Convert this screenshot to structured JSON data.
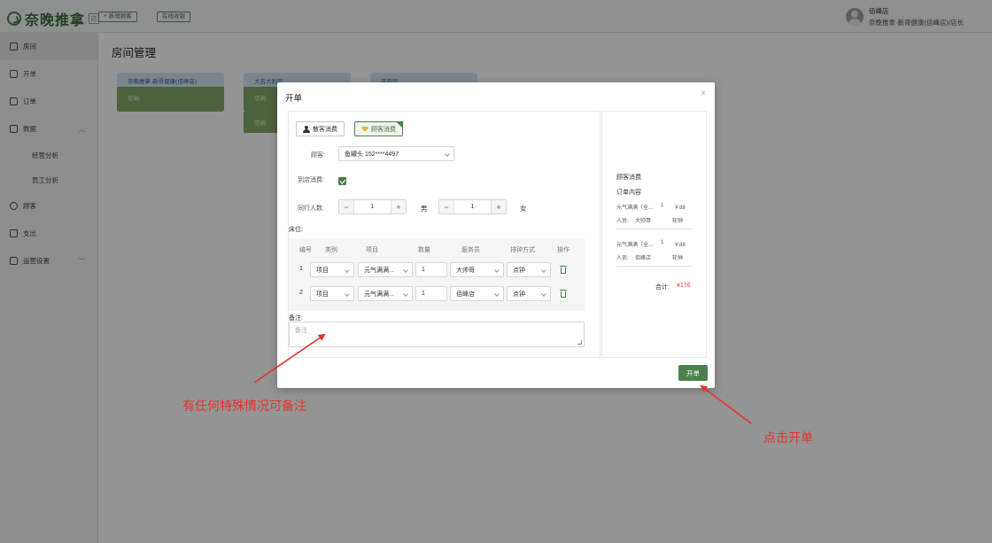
{
  "app": {
    "logo_text": "奈晚推拿",
    "logo_badge": "店",
    "new_guest_label": "+ 新增顾客",
    "online_order_label": "在线收银"
  },
  "user": {
    "name": "佰峰店",
    "store": "奈晚推拿·新哥健康(佰峰店)/店长"
  },
  "sidebar": {
    "items": [
      {
        "label": "房间"
      },
      {
        "label": "开单"
      },
      {
        "label": "订单"
      },
      {
        "label": "数据"
      },
      {
        "label": "顾客"
      },
      {
        "label": "支出"
      },
      {
        "label": "运营设置"
      }
    ],
    "sub_items": [
      {
        "label": "经营分析"
      },
      {
        "label": "员工分析"
      }
    ]
  },
  "main": {
    "title": "房间管理",
    "rooms": [
      {
        "name": "奈晚推拿·新哥健康(佰峰店)",
        "status": "空闲"
      },
      {
        "name": "大吉大利房",
        "status": "空闲"
      },
      {
        "name": "平安房",
        "status": "空闲"
      }
    ],
    "extra_status": "空闲"
  },
  "modal": {
    "title": "开单",
    "close": "×",
    "tab_walkin": "散客消费",
    "tab_member": "顾客消费",
    "customer_label": "顾客:",
    "customer_value": "鱼罐头 152****4497",
    "instore_label": "到店消费:",
    "companions_label": "同行人数:",
    "male_count": "1",
    "male_label": "男",
    "female_count": "1",
    "female_label": "女",
    "beds_label": "床位:",
    "table_headers": [
      "编号",
      "类别",
      "项目",
      "数量",
      "服务员",
      "排钟方式",
      "操作"
    ],
    "rows": [
      {
        "num": "1",
        "category": "项目",
        "item": "元气满满...",
        "qty": "1",
        "staff": "大帅哥",
        "clock": "点钟"
      },
      {
        "num": "2",
        "category": "项目",
        "item": "元气满满...",
        "qty": "1",
        "staff": "佰峰店",
        "clock": "点钟"
      }
    ],
    "remark_label": "备注:",
    "remark_placeholder": "备注",
    "submit_label": "开单"
  },
  "summary": {
    "type": "顾客消费",
    "heading": "订单内容",
    "entries": [
      {
        "item": "元气满满（全...",
        "qty": "1",
        "price": "￥88",
        "staff_label": "人员:",
        "staff": "大帅哥",
        "clock": "轮钟"
      },
      {
        "item": "元气满满（全...",
        "qty": "1",
        "price": "￥88",
        "staff_label": "人员:",
        "staff": "佰峰店",
        "clock": "轮钟"
      }
    ],
    "total_label": "合计:",
    "total_value": "¥176"
  },
  "annotations": {
    "remark_hint": "有任何特殊情况可备注",
    "click_hint": "点击开单"
  },
  "colors": {
    "brand_green": "#4b7f4e",
    "annotation_red": "#e5332a",
    "price_red": "#e04a3a"
  }
}
